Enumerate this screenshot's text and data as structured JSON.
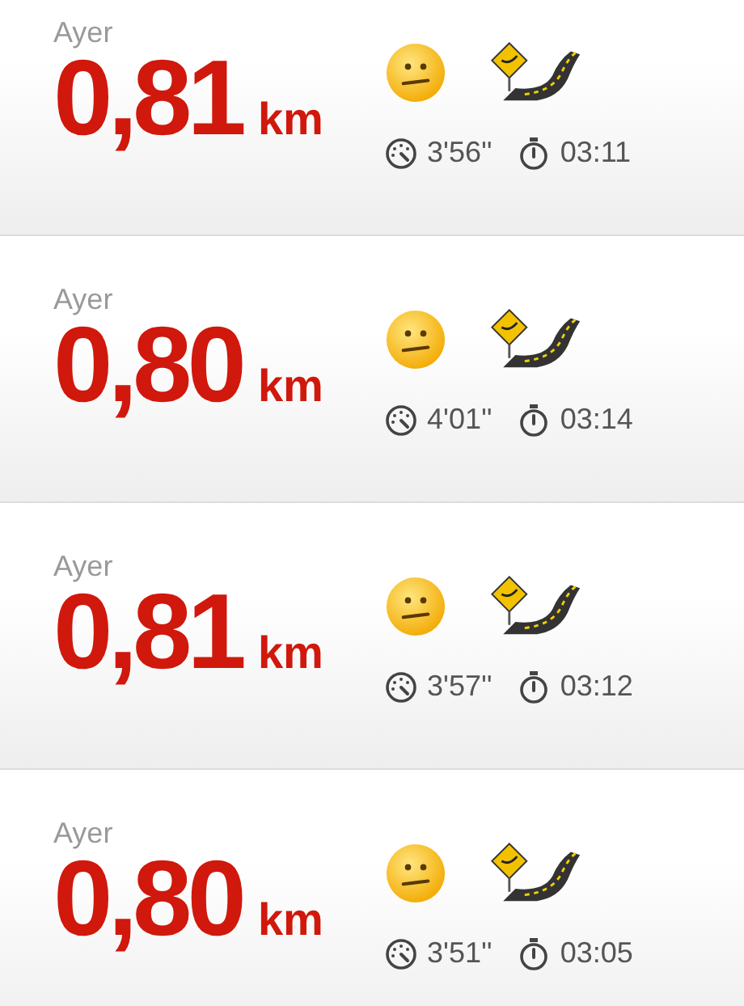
{
  "runs": [
    {
      "day": "Ayer",
      "distance": "0,81",
      "unit": "km",
      "pace": "3'56''",
      "duration": "03:11"
    },
    {
      "day": "Ayer",
      "distance": "0,80",
      "unit": "km",
      "pace": "4'01''",
      "duration": "03:14"
    },
    {
      "day": "Ayer",
      "distance": "0,81",
      "unit": "km",
      "pace": "3'57''",
      "duration": "03:12"
    },
    {
      "day": "Ayer",
      "distance": "0,80",
      "unit": "km",
      "pace": "3'51''",
      "duration": "03:05"
    }
  ]
}
